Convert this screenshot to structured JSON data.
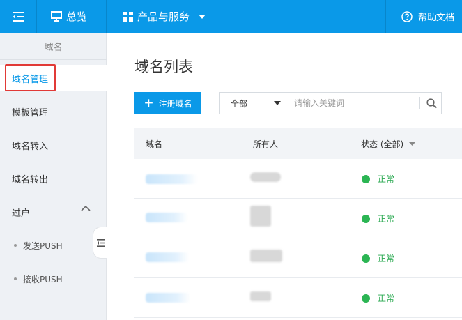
{
  "topbar": {
    "overview_label": "总览",
    "products_label": "产品与服务",
    "help_label": "帮助文档",
    "bg_color": "#0a99e8"
  },
  "sidebar": {
    "title": "域名",
    "items": [
      {
        "label": "域名管理",
        "active": true
      },
      {
        "label": "模板管理"
      },
      {
        "label": "域名转入"
      },
      {
        "label": "域名转出"
      },
      {
        "label": "过户",
        "expanded": true
      }
    ],
    "subitems": [
      {
        "label": "发送PUSH"
      },
      {
        "label": "接收PUSH"
      }
    ]
  },
  "main": {
    "title": "域名列表",
    "add_button_label": "注册域名",
    "filter": {
      "selected": "全部",
      "placeholder": "请输入关键词"
    },
    "table": {
      "headers": {
        "domain": "域名",
        "owner": "所有人",
        "status": "状态 (全部)"
      },
      "rows": [
        {
          "status": "正常"
        },
        {
          "status": "正常"
        },
        {
          "status": "正常"
        },
        {
          "status": "正常"
        }
      ]
    }
  },
  "colors": {
    "accent": "#0a99e8",
    "status_ok": "#2bb553",
    "highlight": "#e13a37"
  }
}
